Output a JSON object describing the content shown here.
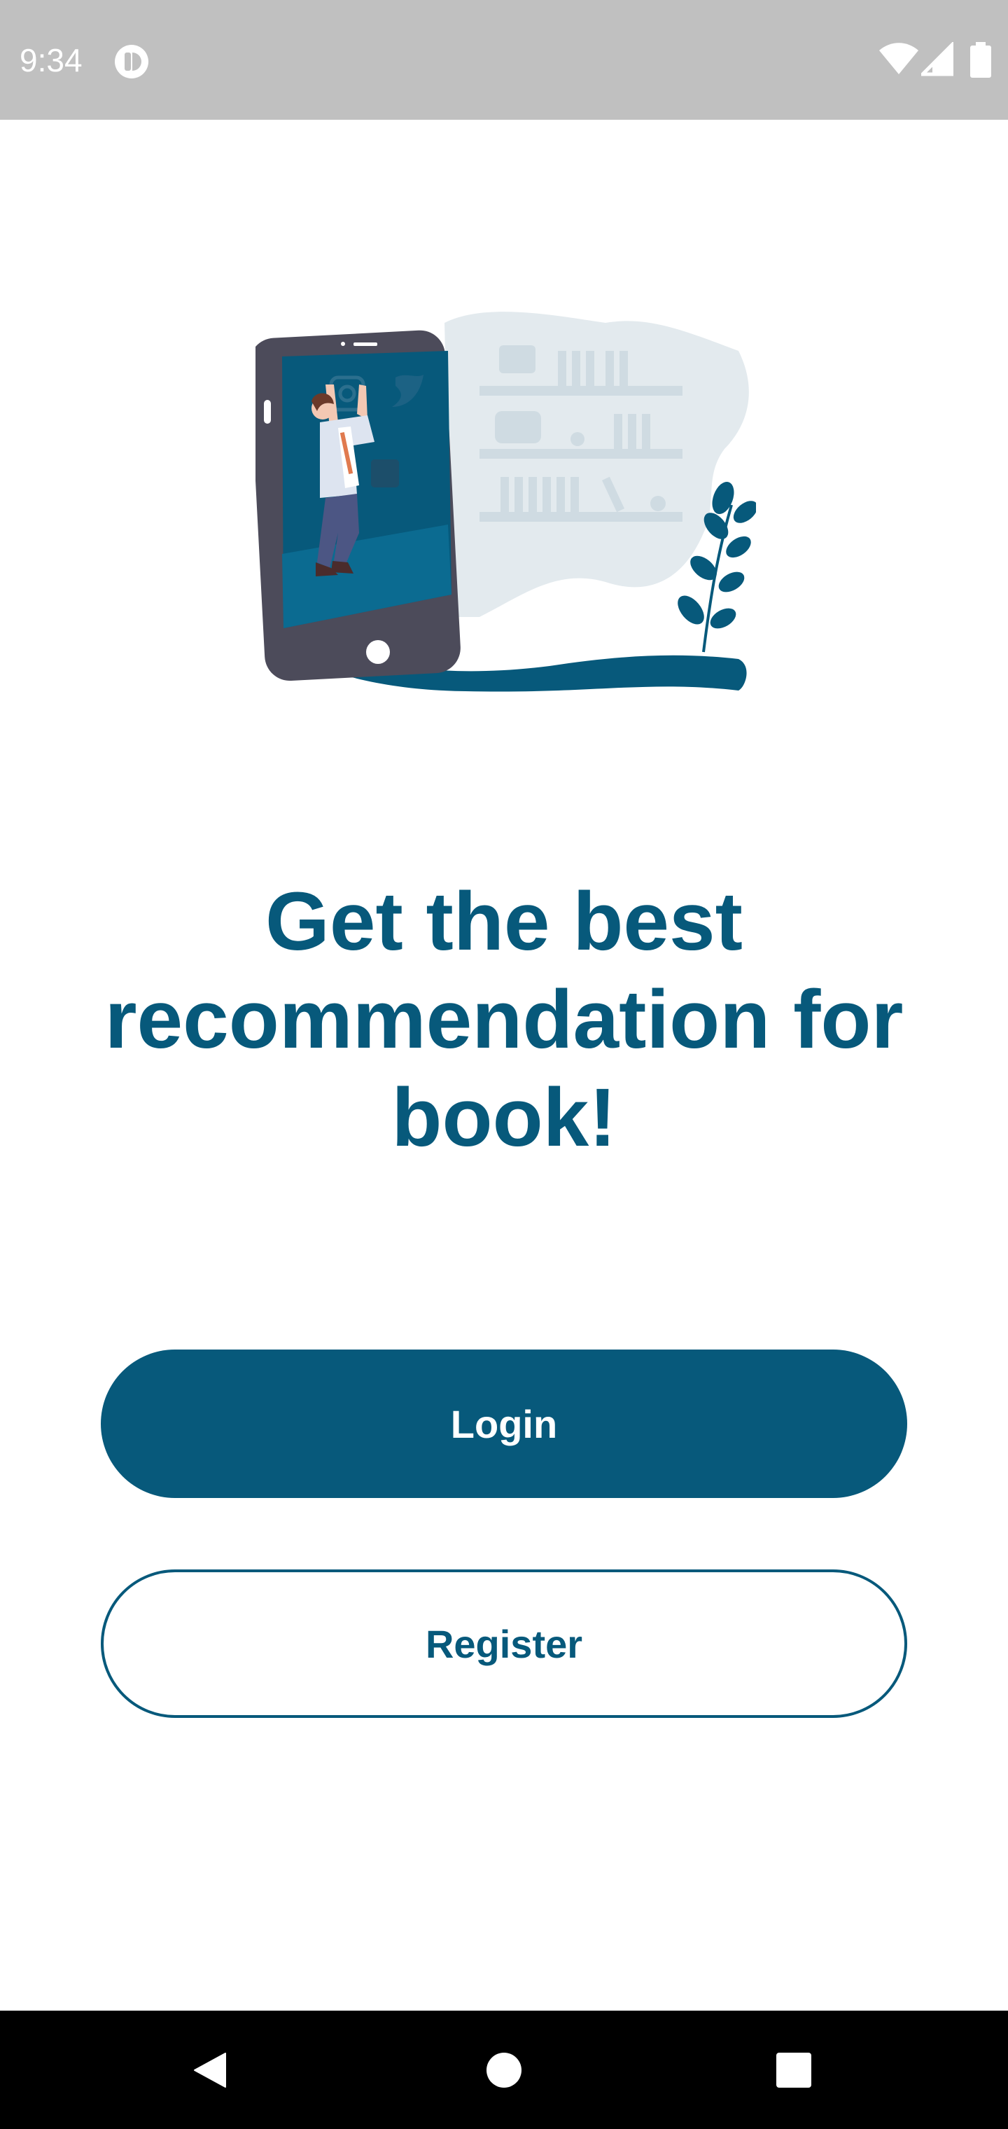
{
  "status_bar": {
    "time": "9:34",
    "icons": [
      "app-notification-icon",
      "wifi-icon",
      "signal-icon",
      "battery-icon"
    ]
  },
  "hero": {
    "illustration": "phone-bookshelf-illustration"
  },
  "headline": {
    "text": "Get the best recommendation for book!"
  },
  "actions": {
    "login_label": "Login",
    "register_label": "Register"
  },
  "nav_bar": {
    "icons": [
      "back-icon",
      "home-icon",
      "recents-icon"
    ]
  },
  "colors": {
    "primary": "#07597b",
    "status_bar": "#c0c0c0",
    "nav_bar": "#000000",
    "background": "#ffffff"
  }
}
